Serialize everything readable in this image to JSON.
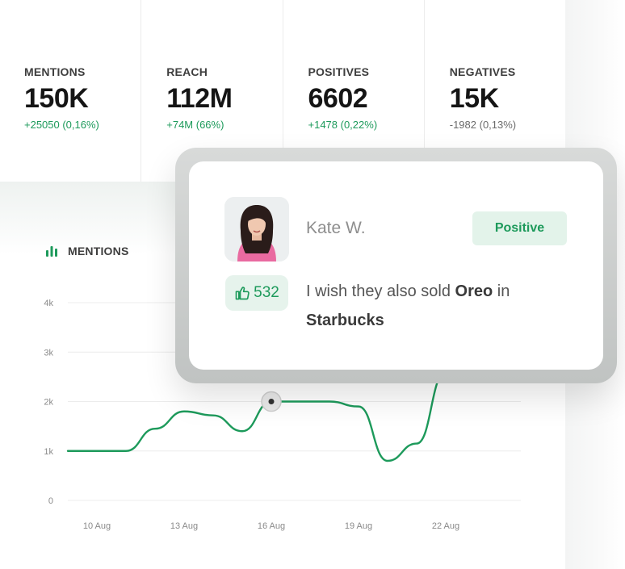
{
  "stats": [
    {
      "label": "MENTIONS",
      "value": "150K",
      "delta": "+25050 (0,16%)",
      "trend": "positive"
    },
    {
      "label": "REACH",
      "value": "112M",
      "delta": "+74M (66%)",
      "trend": "positive"
    },
    {
      "label": "POSITIVES",
      "value": "6602",
      "delta": "+1478 (0,22%)",
      "trend": "positive"
    },
    {
      "label": "NEGATIVES",
      "value": "15K",
      "delta": "-1982 (0,13%)",
      "trend": "neutral"
    }
  ],
  "chart": {
    "title": "MENTIONS",
    "icon": "bar-chart-icon"
  },
  "post": {
    "author": "Kate W.",
    "sentiment": "Positive",
    "likes": "532",
    "text_parts": [
      {
        "text": "I wish they also sold ",
        "bold": false
      },
      {
        "text": "Oreo",
        "bold": true
      },
      {
        "text": " in ",
        "bold": false
      },
      {
        "text": "Starbucks",
        "bold": true
      }
    ],
    "avatar": "avatar-photo",
    "like_icon": "thumbs-up-icon"
  },
  "colors": {
    "accent": "#1d9a5b",
    "accent_light": "#e3f3ea",
    "text_dark": "#151515",
    "negative_delta": "#6b6b6b"
  },
  "chart_data": {
    "type": "line",
    "x": [
      "9 Aug",
      "10 Aug",
      "11 Aug",
      "12 Aug",
      "13 Aug",
      "14 Aug",
      "15 Aug",
      "16 Aug",
      "17 Aug",
      "18 Aug",
      "19 Aug",
      "20 Aug",
      "21 Aug",
      "22 Aug"
    ],
    "x_ticks": [
      "10 Aug",
      "13 Aug",
      "16 Aug",
      "19 Aug",
      "22 Aug"
    ],
    "series": [
      {
        "values": [
          1000,
          1000,
          1000,
          1450,
          1800,
          1720,
          1400,
          2000,
          2000,
          2000,
          1900,
          800,
          1150,
          2600
        ]
      }
    ],
    "y_ticks": [
      "0",
      "1k",
      "2k",
      "3k",
      "4k"
    ],
    "ylim": [
      0,
      4000
    ],
    "highlight_index": 7,
    "grid": true
  }
}
